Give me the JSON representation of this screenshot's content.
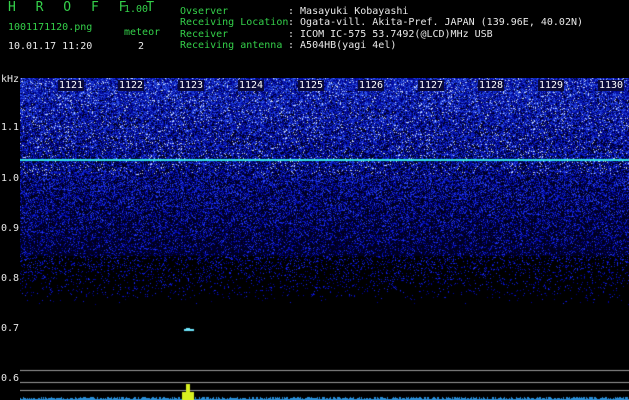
{
  "app": {
    "name": "H R O F F T",
    "version": "1.00"
  },
  "file": {
    "name": "1001171120.png",
    "datetime": "10.01.17 11:20"
  },
  "meteor": {
    "label": "meteor",
    "count": "2"
  },
  "info": {
    "observer_key": "Ovserver",
    "observer_val": ": Masayuki Kobayashi",
    "location_key": "Receiving Location",
    "location_val": ": Ogata-vill. Akita-Pref. JAPAN (139.96E, 40.02N)",
    "receiver_key": "Receiver",
    "receiver_val": ": ICOM IC-575 53.7492(@LCD)MHz USB",
    "antenna_key": "Receiving antenna",
    "antenna_val": ": A504HB(yagi 4el)"
  },
  "y_axis": {
    "unit": "kHz",
    "ticks": [
      "1.1",
      "1.0",
      "0.9",
      "0.8",
      "0.7",
      "0.6"
    ]
  },
  "x_axis": {
    "ticks": [
      "1121",
      "1122",
      "1123",
      "1124",
      "1125",
      "1126",
      "1127",
      "1128",
      "1129",
      "1130"
    ]
  },
  "colors": {
    "logo": "#34d04a",
    "noise": "#2c4bd8",
    "carrier": "#33e0e6",
    "meteor": "#d8f020"
  }
}
